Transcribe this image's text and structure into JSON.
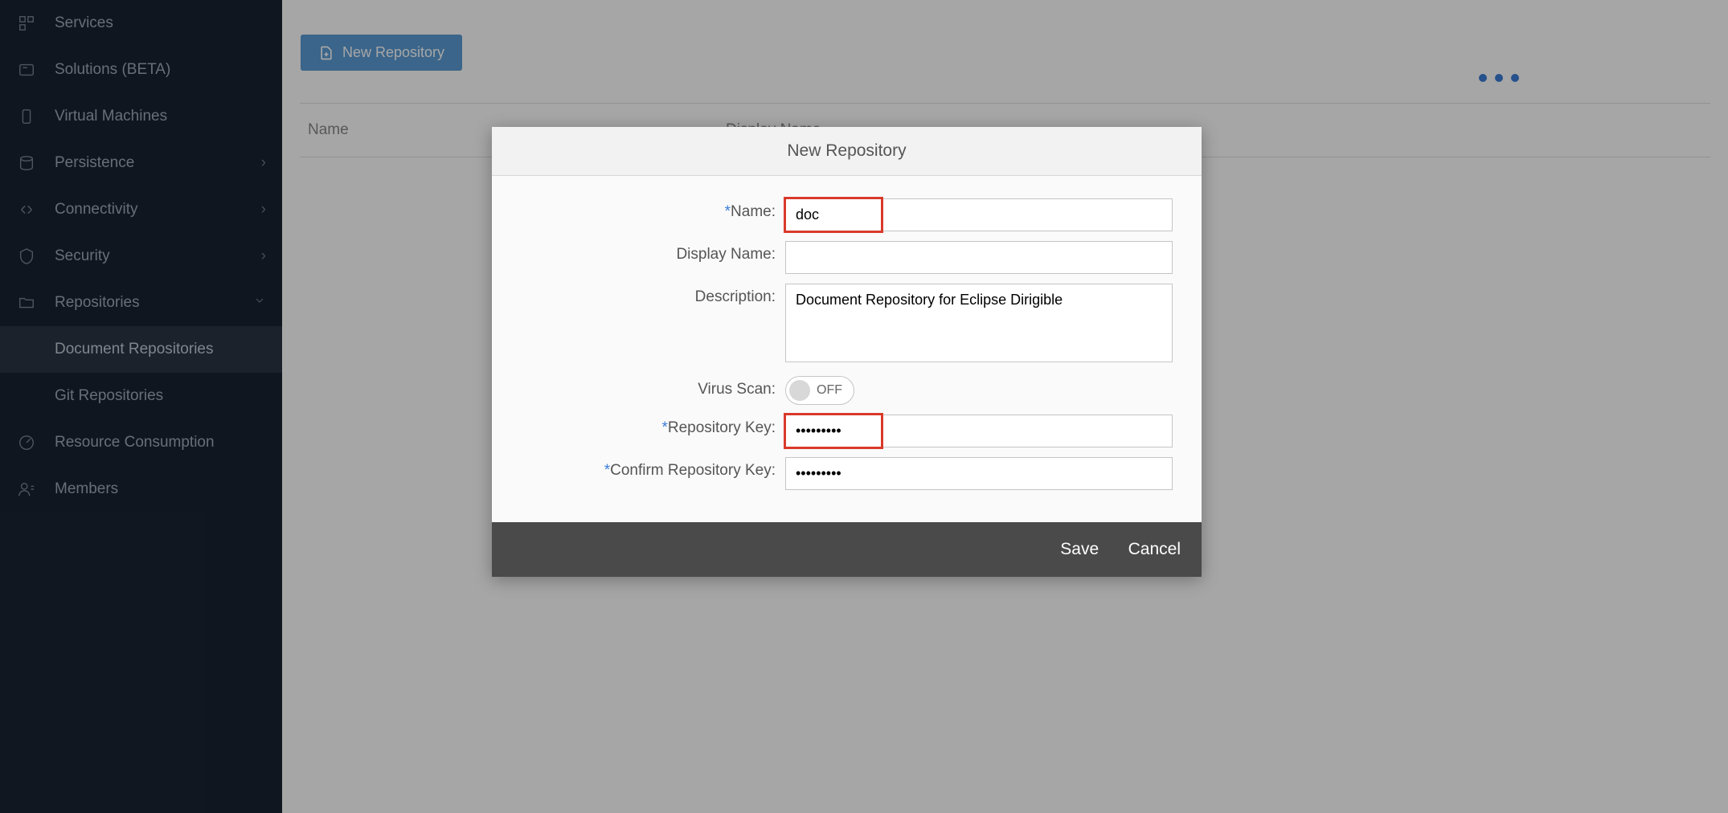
{
  "sidebar": {
    "items": [
      {
        "label": "Services"
      },
      {
        "label": "Solutions (BETA)"
      },
      {
        "label": "Virtual Machines"
      },
      {
        "label": "Persistence",
        "chevron": true
      },
      {
        "label": "Connectivity",
        "chevron": true
      },
      {
        "label": "Security",
        "chevron": true
      },
      {
        "label": "Repositories",
        "chevron": true,
        "expanded": true
      },
      {
        "label": "Resource Consumption"
      },
      {
        "label": "Members"
      }
    ],
    "subitems": [
      {
        "label": "Document Repositories",
        "active": true
      },
      {
        "label": "Git Repositories"
      }
    ]
  },
  "toolbar": {
    "new_repo": "New Repository"
  },
  "table": {
    "col_name": "Name",
    "col_display": "Display Name"
  },
  "modal": {
    "title": "New Repository",
    "labels": {
      "name": "Name:",
      "display_name": "Display Name:",
      "description": "Description:",
      "virus_scan": "Virus Scan:",
      "repo_key": "Repository Key:",
      "confirm_key": "Confirm Repository Key:"
    },
    "values": {
      "name": "doc",
      "display_name": "",
      "description": "Document Repository for Eclipse Dirigible",
      "virus_scan": "OFF",
      "repo_key": "•••••••••",
      "confirm_key": "•••••••••"
    },
    "footer": {
      "save": "Save",
      "cancel": "Cancel"
    }
  }
}
